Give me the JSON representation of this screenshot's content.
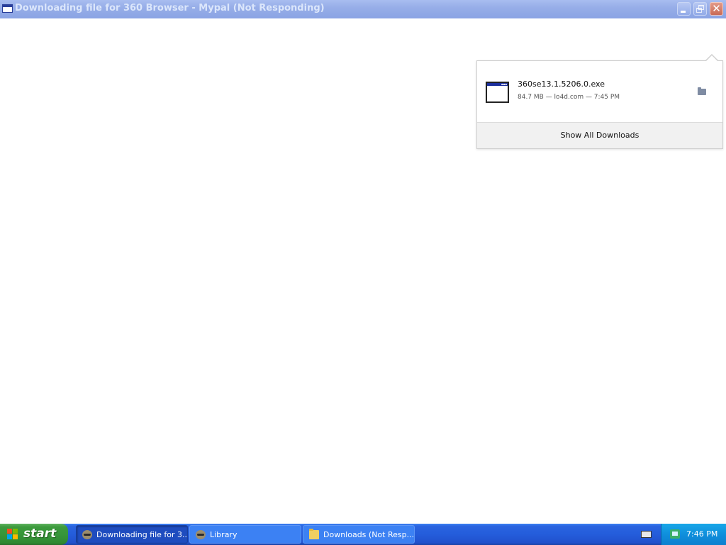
{
  "window": {
    "title": "Downloading file for 360 Browser - Mypal (Not Responding)"
  },
  "downloads_panel": {
    "items": [
      {
        "filename": "360se13.1.5206.0.exe",
        "meta": "84.7 MB — lo4d.com — 7:45 PM",
        "icon": "application-window-icon"
      }
    ],
    "footer_label": "Show All Downloads"
  },
  "taskbar": {
    "start_label": "start",
    "tasks": [
      {
        "label": "Downloading file for 3...",
        "icon": "mypal-raccoon-icon",
        "active": true
      },
      {
        "label": "Library",
        "icon": "mypal-raccoon-icon",
        "active": false
      },
      {
        "label": "Downloads (Not Resp...",
        "icon": "folder-icon",
        "active": false
      }
    ],
    "clock": "7:46 PM"
  },
  "colors": {
    "titlebar_inactive": "#97aee8",
    "taskbar_blue": "#245ddb",
    "start_green": "#37963a",
    "tray_blue": "#0f8fdc"
  }
}
